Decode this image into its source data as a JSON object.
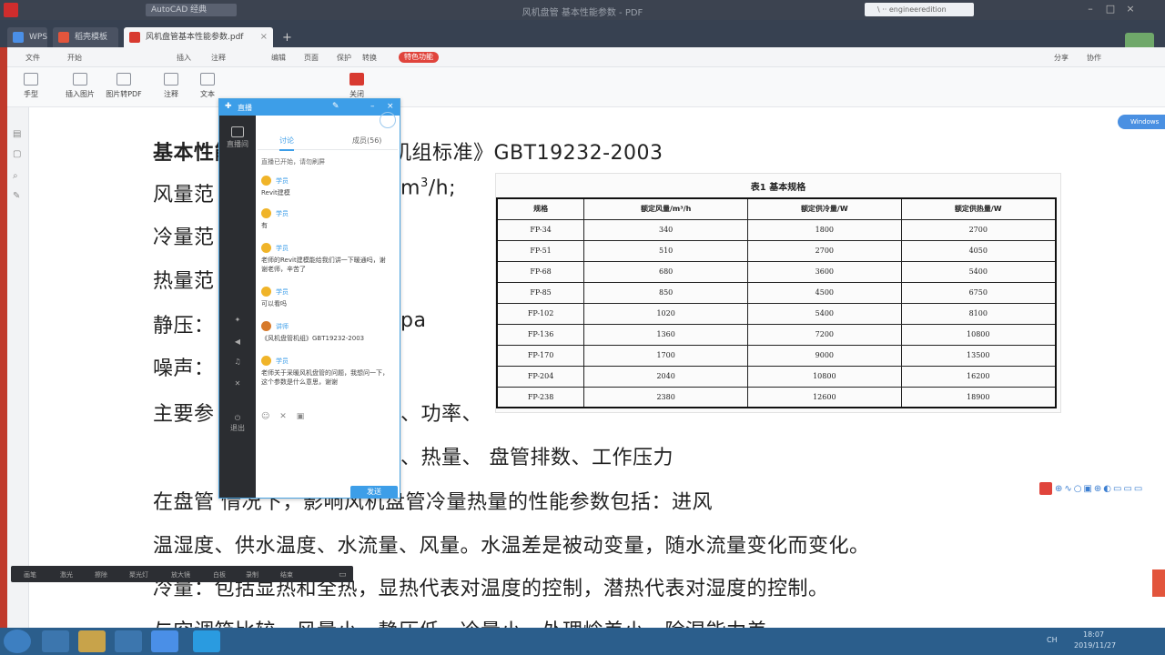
{
  "window": {
    "app_tab": "AutoCAD 经典",
    "title": "风机盘管 基本性能参数 - PDF",
    "url_box": "\\ ·· engineeredition"
  },
  "browser_tabs": [
    {
      "label": "WPS",
      "color": "#4a8fe7"
    },
    {
      "label": "稻壳模板",
      "color": "#e2553c"
    },
    {
      "label": "风机盘管基本性能参数.pdf",
      "color": "#d83a30"
    }
  ],
  "new_tab_label": "+",
  "menu": {
    "items": [
      "文件",
      "开始",
      "插入",
      "注释",
      "编辑",
      "页面",
      "保护",
      "转换"
    ],
    "highlight": "特色功能",
    "right_items": [
      "分享",
      "协作"
    ]
  },
  "tools": [
    {
      "label": "手型"
    },
    {
      "label": "插入图片"
    },
    {
      "label": "图片转PDF"
    },
    {
      "label": "注释"
    },
    {
      "label": "文本"
    },
    {
      "label": "关闭"
    }
  ],
  "document": {
    "line1_bold": "基本性能",
    "line1_rest": "机组标准》GBT19232-2003",
    "line2_label": "风量范",
    "line2_unit": "m",
    "line2_sup": "3",
    "line2_after": "/h;",
    "line3_label": "冷量范",
    "line4_label": "热量范",
    "line5_label": "静压：",
    "line5_unit": "pa",
    "line6_label": "噪声：",
    "line7_label": "主要参",
    "line7_rest": "、功率、",
    "line8_rest": "、热量、  盘管排数、工作压力",
    "para1": "在盘管                情况下，影响风机盘管冷量热量的性能参数包括：进风",
    "para2": "温湿度、供水温度、水流量、风量。水温差是被动变量，随水流量变化而变化。",
    "para3": "冷量：包括显热和全热，显热代表对温度的控制，潜热代表对湿度的控制。",
    "para4": "与空调箱比较，风量小、静压低、冷量小、处理焓差小、除湿能力差"
  },
  "spec_table": {
    "caption": "表1  基本规格",
    "headers": [
      "规格",
      "额定风量/m³/h",
      "额定供冷量/W",
      "额定供热量/W"
    ],
    "rows": [
      [
        "FP-34",
        "340",
        "1800",
        "2700"
      ],
      [
        "FP-51",
        "510",
        "2700",
        "4050"
      ],
      [
        "FP-68",
        "680",
        "3600",
        "5400"
      ],
      [
        "FP-85",
        "850",
        "4500",
        "6750"
      ],
      [
        "FP-102",
        "1020",
        "5400",
        "8100"
      ],
      [
        "FP-136",
        "1360",
        "7200",
        "10800"
      ],
      [
        "FP-170",
        "1700",
        "9000",
        "13500"
      ],
      [
        "FP-204",
        "2040",
        "10800",
        "16200"
      ],
      [
        "FP-238",
        "2380",
        "12600",
        "18900"
      ]
    ]
  },
  "chat": {
    "title": "直播",
    "tabs": [
      "讨论",
      "成员(56)"
    ],
    "subtitle": "直播已开始，请勿刷屏",
    "rail": [
      "直播间",
      "",
      "",
      "",
      "",
      "退出"
    ],
    "messages": [
      {
        "who": "学员",
        "text": "Revit建模"
      },
      {
        "who": "学员",
        "text": "有"
      },
      {
        "who": "学员",
        "text": "老师的Revit建模能给我们讲一下暖通吗，谢谢老师，辛苦了"
      },
      {
        "who": "学员",
        "text": "可以看吗"
      },
      {
        "who": "讲师",
        "text": "《风机盘管机组》GBT19232-2003"
      },
      {
        "who": "学员",
        "text": "老师关于采暖风机盘管的问题，我想问一下，这个参数是什么意思，谢谢"
      }
    ],
    "send_label": "发送"
  },
  "darkbar_items": [
    "画笔",
    "激光",
    "擦除",
    "聚光灯",
    "放大镜",
    "白板",
    "录制",
    "结束"
  ],
  "right_float": "Windows",
  "taskbar": {
    "clock": "18:07",
    "date": "2019/11/27",
    "tray": "CH"
  }
}
